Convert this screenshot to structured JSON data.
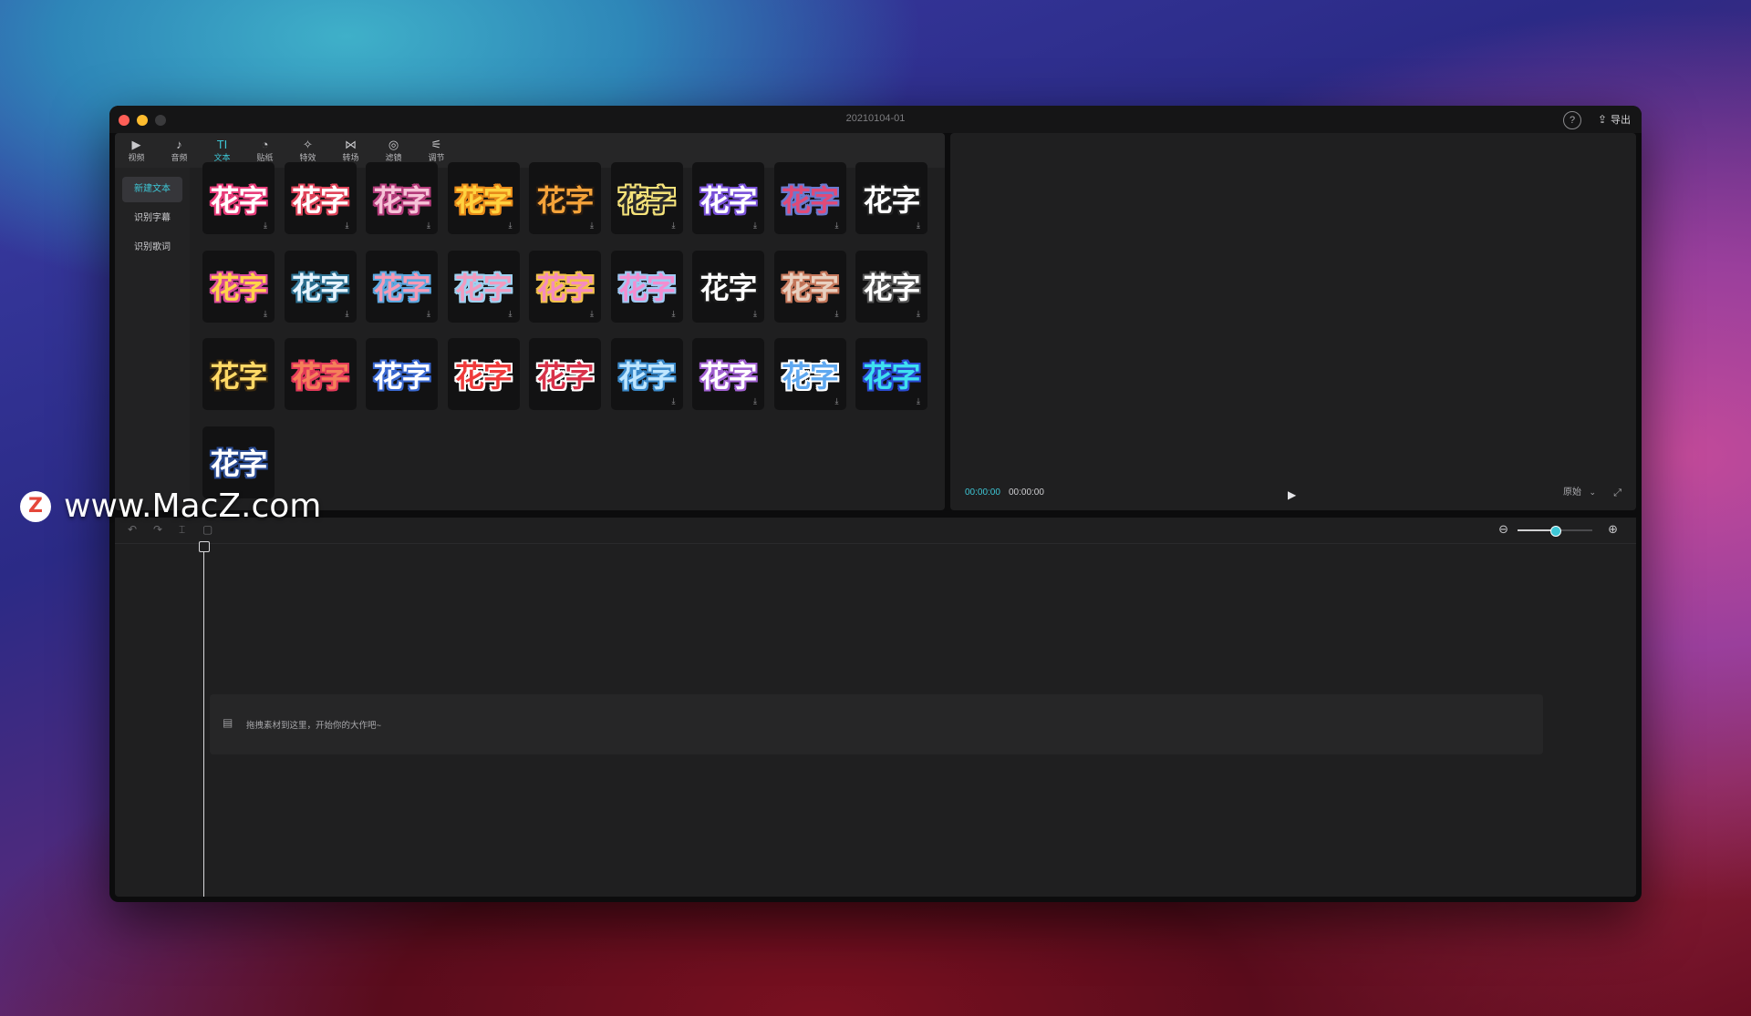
{
  "window": {
    "title": "20210104-01",
    "export_label": "导出",
    "help_glyph": "?"
  },
  "toolbar": {
    "tabs": [
      {
        "glyph": "▶",
        "label": "视频"
      },
      {
        "glyph": "♪",
        "label": "音频"
      },
      {
        "glyph": "TI",
        "label": "文本"
      },
      {
        "glyph": "◔",
        "label": "贴纸"
      },
      {
        "glyph": "✧",
        "label": "特效"
      },
      {
        "glyph": "⋈",
        "label": "转场"
      },
      {
        "glyph": "◎",
        "label": "滤镜"
      },
      {
        "glyph": "⚟",
        "label": "调节"
      }
    ],
    "active_tab": "文本"
  },
  "sidebar": {
    "items": [
      {
        "label": "新建文本",
        "active": true
      },
      {
        "label": "识别字幕",
        "active": false
      },
      {
        "label": "识别歌词",
        "active": false
      }
    ]
  },
  "text_presets": {
    "label": "花字",
    "tiles": [
      {
        "color": "#ffffff",
        "outline": "#e83d7a",
        "download": true
      },
      {
        "color": "#ffffff",
        "outline": "#e0445a",
        "download": true
      },
      {
        "color": "#f6c3d8",
        "outline": "#b43b7a",
        "download": true
      },
      {
        "color": "#ffd340",
        "outline": "#e88a1a",
        "download": true
      },
      {
        "color": "#f5a33a",
        "outline": "#2a1c10",
        "download": true
      },
      {
        "color": "#2a2a2a",
        "outline": "#f5e27a",
        "download": true
      },
      {
        "color": "#ffffff",
        "outline": "#7a52d9",
        "download": true
      },
      {
        "color": "#e04a78",
        "outline": "#6a7ad0",
        "download": true
      },
      {
        "color": "#ffffff",
        "outline": "#222222",
        "download": true
      },
      {
        "color": "#ffd24a",
        "outline": "#d94a9b",
        "download": true
      },
      {
        "color": "#e6f4ff",
        "outline": "#2d6f8f",
        "download": true
      },
      {
        "color": "#f59ab6",
        "outline": "#5ba8e0",
        "download": true
      },
      {
        "color": "#f29bbf",
        "outline": "#9dd1f0",
        "download": true
      },
      {
        "color": "#f58bbf",
        "outline": "#f2c14a",
        "download": true
      },
      {
        "color": "#f38dd0",
        "outline": "#9fc9f2",
        "download": true
      },
      {
        "color": "#ffffff",
        "outline": "#1a1a1a",
        "download": true
      },
      {
        "color": "#e8d0c0",
        "outline": "#c4765a",
        "download": true
      },
      {
        "color": "#ffffff",
        "outline": "#555555",
        "download": true
      },
      {
        "color": "#ffd966",
        "outline": "#3a2a10",
        "download": false
      },
      {
        "color": "#f5805a",
        "outline": "#e2395a",
        "download": false
      },
      {
        "color": "#ffffff",
        "outline": "#3a68d0",
        "download": false
      },
      {
        "color": "#ef3a3a",
        "outline": "#ffffff",
        "download": false
      },
      {
        "color": "#d8324a",
        "outline": "#ffffff",
        "download": false
      },
      {
        "color": "#bfe6ff",
        "outline": "#3a88c8",
        "download": true
      },
      {
        "color": "#ffffff",
        "outline": "#a060d0",
        "download": true
      },
      {
        "color": "#5fa8f0",
        "outline": "#ffffff",
        "download": true
      },
      {
        "color": "#3ee0f0",
        "outline": "#2a4ad0",
        "download": true
      },
      {
        "color": "#ffffff",
        "outline": "#2a4a90",
        "download": false
      }
    ]
  },
  "player": {
    "current_time": "00:00:00",
    "total_time": "00:00:00",
    "ratio_label": "原始"
  },
  "timeline": {
    "drop_hint": "拖拽素材到这里，开始你的大作吧~",
    "zoom_level": 0.5
  },
  "watermark": {
    "logo": "Z",
    "text": "www.MacZ.com"
  },
  "colors": {
    "accent": "#3ec7d6",
    "panel": "#1f1f20",
    "window": "#0c0c0d"
  }
}
